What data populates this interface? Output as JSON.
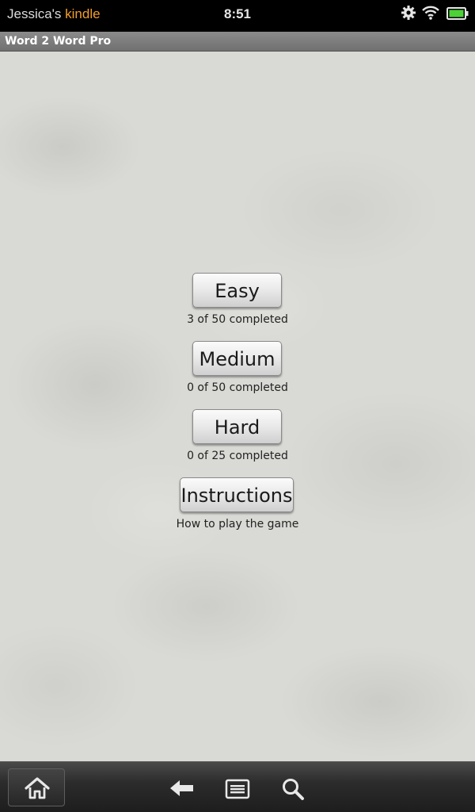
{
  "status_bar": {
    "owner_prefix": "Jessica's ",
    "owner_brand": "kindle",
    "time": "8:51",
    "icons": [
      "gear-icon",
      "wifi-icon",
      "battery-icon"
    ]
  },
  "app": {
    "title": "Word 2 Word Pro"
  },
  "menu": [
    {
      "label": "Easy",
      "caption": "3 of 50 completed"
    },
    {
      "label": "Medium",
      "caption": "0 of 50 completed"
    },
    {
      "label": "Hard",
      "caption": "0 of 25 completed"
    },
    {
      "label": "Instructions",
      "caption": "How to play the game"
    }
  ],
  "nav_bar": {
    "icons": [
      "home-icon",
      "back-icon",
      "menu-icon",
      "search-icon"
    ]
  },
  "colors": {
    "brand_accent": "#f39c2a",
    "battery_green": "#4cd137"
  }
}
